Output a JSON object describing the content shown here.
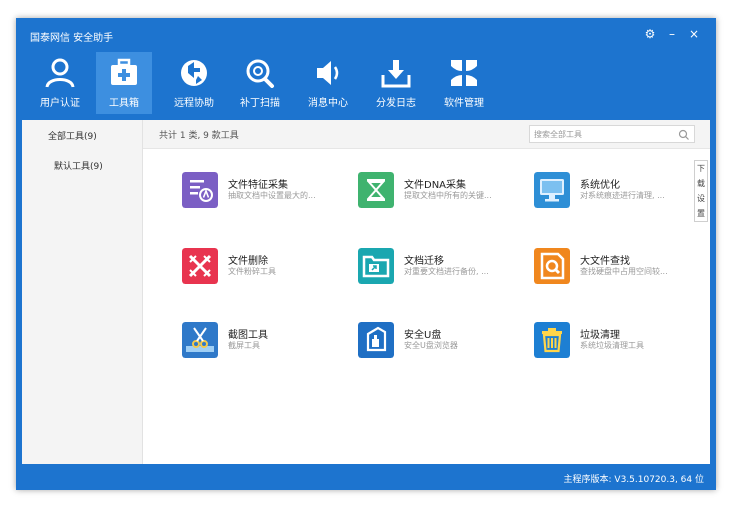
{
  "window": {
    "title": "国泰网信 安全助手"
  },
  "controls": {
    "settings": "⚙",
    "minimize": "–",
    "close": "×"
  },
  "nav": [
    {
      "label": "用户认证",
      "icon": "user-icon"
    },
    {
      "label": "工具箱",
      "icon": "toolbox-icon",
      "active": true
    },
    {
      "label": "远程协助",
      "icon": "remote-icon"
    },
    {
      "label": "补丁扫描",
      "icon": "patch-scan-icon"
    },
    {
      "label": "消息中心",
      "icon": "speaker-icon"
    },
    {
      "label": "分发日志",
      "icon": "download-tray-icon"
    },
    {
      "label": "软件管理",
      "icon": "apps-icon"
    }
  ],
  "sidebar": {
    "items": [
      {
        "label": "全部工具(9)",
        "selected": true
      },
      {
        "label": "默认工具(9)",
        "selected": false
      }
    ]
  },
  "toolbar": {
    "summary": "共计 1 类, 9 款工具",
    "search_placeholder": "搜索全部工具"
  },
  "side_tab": {
    "label": "下载设置"
  },
  "tools": [
    {
      "name": "文件特征采集",
      "desc": "抽取文档中设置最大的...",
      "color": "#7b5fc4",
      "icon": "file-feature-icon"
    },
    {
      "name": "文件DNA采集",
      "desc": "提取文档中所有的关键...",
      "color": "#3fb36f",
      "icon": "hourglass-icon"
    },
    {
      "name": "系统优化",
      "desc": "对系统痕迹进行清理, ...",
      "color": "#2e8fd6",
      "icon": "monitor-icon"
    },
    {
      "name": "文件删除",
      "desc": "文件粉碎工具",
      "color": "#e8344f",
      "icon": "shred-icon"
    },
    {
      "name": "文档迁移",
      "desc": "对重要文档进行备份, ...",
      "color": "#1aa7b0",
      "icon": "folder-move-icon"
    },
    {
      "name": "大文件查找",
      "desc": "查找硬盘中占用空间较...",
      "color": "#f0871e",
      "icon": "file-search-icon"
    },
    {
      "name": "截图工具",
      "desc": "截屏工具",
      "color": "#2f79c9",
      "icon": "scissors-icon"
    },
    {
      "name": "安全U盘",
      "desc": "安全U盘浏览器",
      "color": "#1f6fc4",
      "icon": "usb-drive-icon"
    },
    {
      "name": "垃圾清理",
      "desc": "系统垃圾清理工具",
      "color": "#1d7fd3",
      "icon": "trash-icon"
    }
  ],
  "status": {
    "version": "主程序版本: V3.5.10720.3, 64 位"
  }
}
